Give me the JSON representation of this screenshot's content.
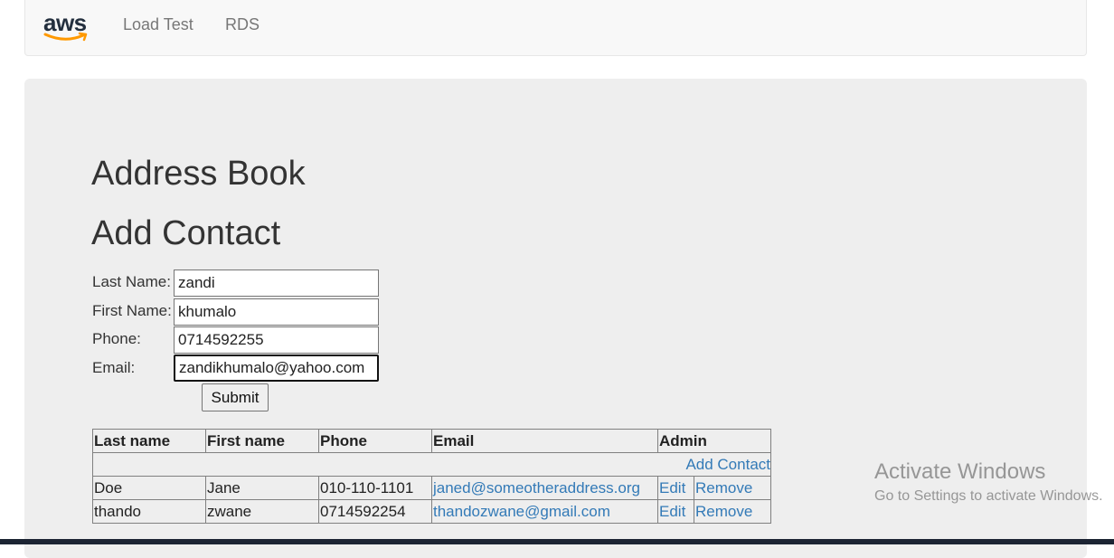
{
  "navbar": {
    "brand": "aws",
    "links": [
      "Load Test",
      "RDS"
    ]
  },
  "main": {
    "title": "Address Book",
    "subtitle": "Add Contact"
  },
  "form": {
    "last_name_label": "Last Name:",
    "last_name_value": "zandi",
    "first_name_label": "First Name:",
    "first_name_value": "khumalo",
    "phone_label": "Phone:",
    "phone_value": "0714592255",
    "email_label": "Email:",
    "email_value": "zandikhumalo@yahoo.com",
    "submit_label": "Submit"
  },
  "table": {
    "headers": [
      "Last name",
      "First name",
      "Phone",
      "Email",
      "Admin"
    ],
    "add_contact_link": "Add Contact",
    "rows": [
      {
        "last": "Doe",
        "first": "Jane",
        "phone": "010-110-1101",
        "email": "janed@someotheraddress.org",
        "edit": "Edit",
        "remove": "Remove"
      },
      {
        "last": "thando",
        "first": "zwane",
        "phone": "0714592254",
        "email": "thandozwane@gmail.com",
        "edit": "Edit",
        "remove": "Remove"
      }
    ]
  },
  "watermark": {
    "title": "Activate Windows",
    "subtitle": "Go to Settings to activate Windows."
  },
  "colors": {
    "link": "#337ab7",
    "jumbotron": "#eeeeee",
    "navbar": "#f8f8f8",
    "aws_orange": "#ff9900",
    "aws_dark": "#232f3e"
  }
}
